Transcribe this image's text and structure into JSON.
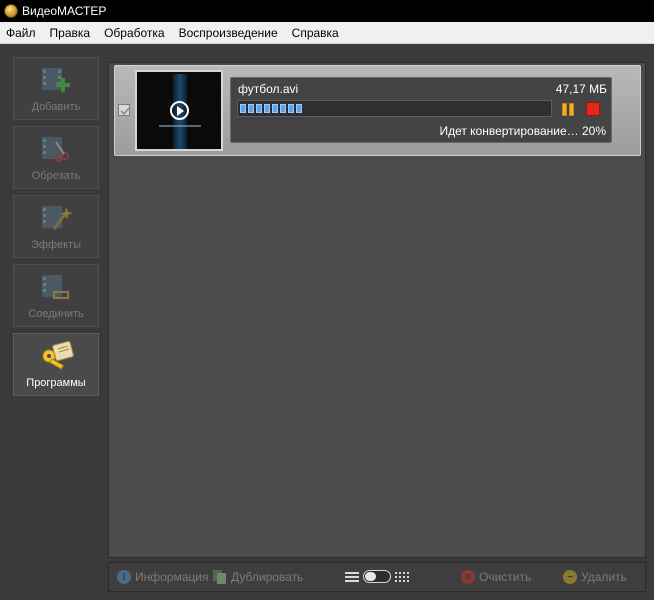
{
  "window": {
    "title": "ВидеоМАСТЕР"
  },
  "menu": [
    "Файл",
    "Правка",
    "Обработка",
    "Воспроизведение",
    "Справка"
  ],
  "sidebar": [
    {
      "label": "Добавить",
      "icon": "add-video-icon",
      "active": false
    },
    {
      "label": "Обрезать",
      "icon": "cut-video-icon",
      "active": false
    },
    {
      "label": "Эффекты",
      "icon": "effects-wand-icon",
      "active": false
    },
    {
      "label": "Соединить",
      "icon": "join-video-icon",
      "active": false
    },
    {
      "label": "Программы",
      "icon": "key-programs-icon",
      "active": true
    }
  ],
  "file": {
    "name": "футбол.avi",
    "size": "47,17 МБ",
    "status": "Идет конвертирование… 20%",
    "progress_percent": 20,
    "checked": true
  },
  "bottombar": {
    "info_label": "Информация",
    "duplicate_label": "Дублировать",
    "clear_label": "Очистить",
    "delete_label": "Удалить"
  },
  "colors": {
    "progress": "#5fa3e8",
    "pause": "#f0b02a",
    "stop": "#e02a1a"
  }
}
